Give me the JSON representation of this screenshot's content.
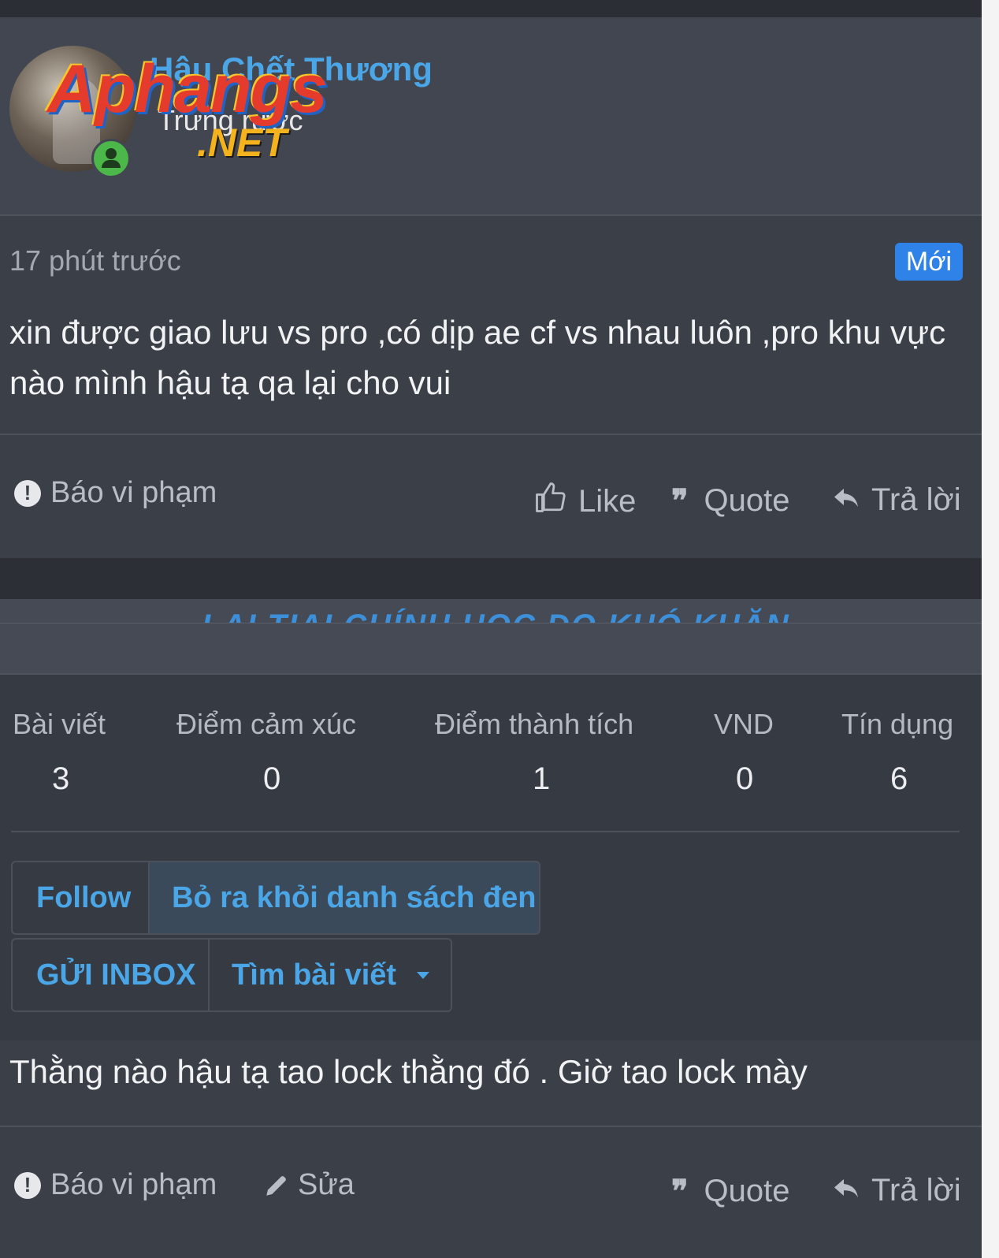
{
  "post1": {
    "username": "Hậu Chết Thương",
    "rank": "Trứng rước",
    "time": "17 phút trước",
    "badge": "Mới",
    "content": "xin được giao lưu vs pro ,có dịp ae cf vs nhau luôn ,pro khu vực nào mình hậu tạ qa lại cho vui",
    "actions": {
      "report": "Báo vi phạm",
      "like": "Like",
      "quote": "Quote",
      "reply": "Trả lời"
    }
  },
  "watermark": {
    "main": "Aphangs",
    "sub": ".NET"
  },
  "profile_card": {
    "banner_text": "LẠI TIAI CHÍNH HỌC DO KHÓ KHĂN",
    "stats": [
      {
        "label": "Bài viết",
        "value": "3"
      },
      {
        "label": "Điểm cảm xúc",
        "value": "0"
      },
      {
        "label": "Điểm thành tích",
        "value": "1"
      },
      {
        "label": "VND",
        "value": "0"
      },
      {
        "label": "Tín dụng",
        "value": "6"
      }
    ],
    "buttons": {
      "follow": "Follow",
      "unblock": "Bỏ ra khỏi danh sách đen",
      "inbox": "GỬI INBOX",
      "find_posts": "Tìm bài viết"
    }
  },
  "post2": {
    "content": "Thằng nào hậu tạ tao lock thằng đó . Giờ tao lock mày",
    "actions": {
      "report": "Báo vi phạm",
      "edit": "Sửa",
      "quote": "Quote",
      "reply": "Trả lời"
    }
  }
}
